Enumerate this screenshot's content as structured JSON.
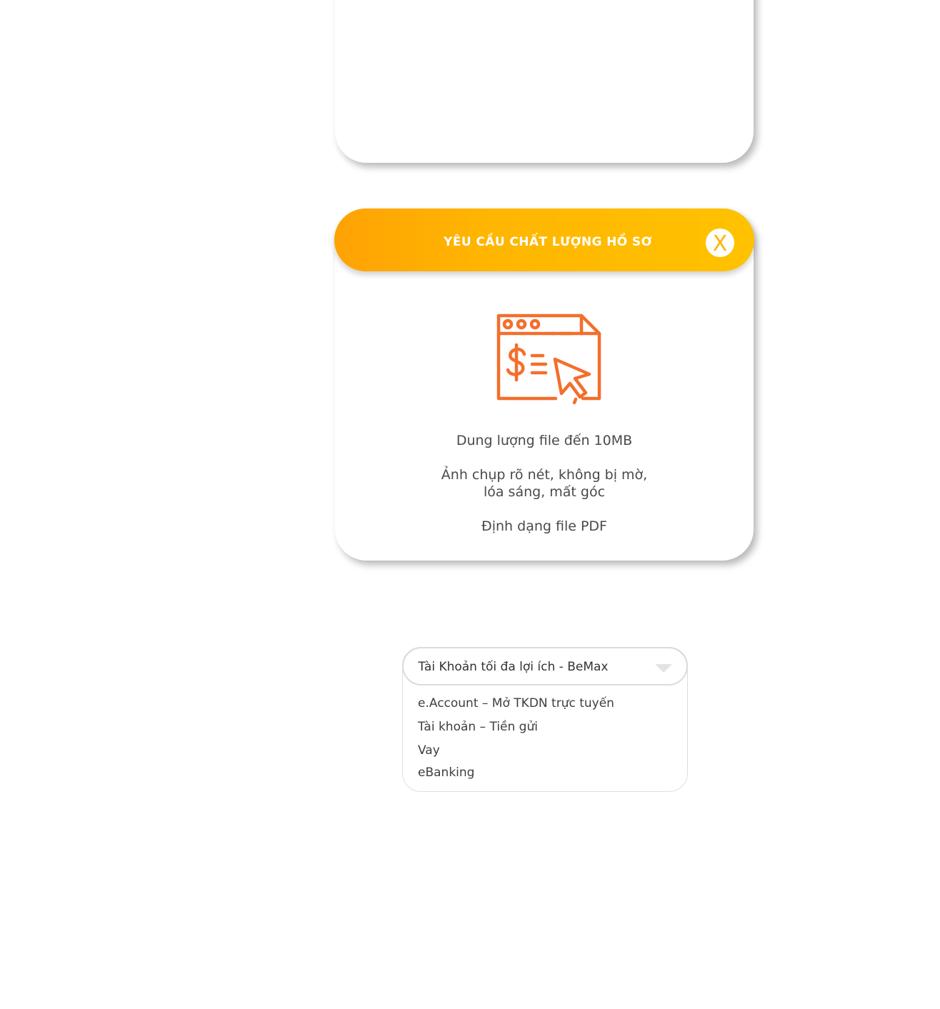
{
  "modal": {
    "title": "YÊU CẦU CHẤT LƯỢNG HỒ SƠ",
    "close_label": "X",
    "icon": "payment-document-cursor-icon",
    "requirements": [
      "Dung lượng file đến 10MB",
      "Ảnh chụp rõ nét, không bị mờ,",
      "lóa sáng, mất góc",
      "Định dạng file PDF"
    ]
  },
  "dropdown": {
    "selected": "Tài Khoản tối đa lợi ích - BeMax",
    "options": [
      "e.Account – Mở TKDN trực tuyến",
      "Tài khoản – Tiền gửi",
      "Vay",
      "eBanking"
    ]
  },
  "colors": {
    "header_gradient_start": "#ffa205",
    "header_gradient_end": "#ffc200",
    "icon_orange": "#f36f2b",
    "text_gray": "#4a4a4a"
  }
}
